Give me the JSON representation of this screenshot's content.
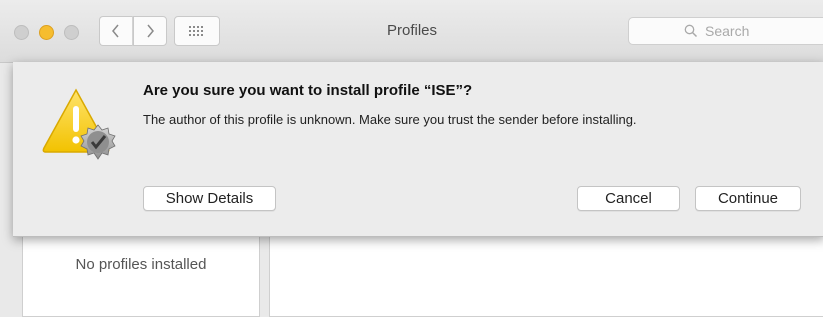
{
  "window": {
    "title": "Profiles",
    "search_placeholder": "Search"
  },
  "sidebar": {
    "empty_text": "No profiles installed"
  },
  "dialog": {
    "headline": "Are you sure you want to install profile “ISE”?",
    "message": "The author of this profile is unknown. Make sure you trust the sender before installing.",
    "icon": "warning-icon",
    "buttons": {
      "show_details": "Show Details",
      "cancel": "Cancel",
      "continue": "Continue"
    }
  },
  "colors": {
    "warning_yellow": "#f2c200",
    "minimize_light": "#f6bd2f"
  }
}
